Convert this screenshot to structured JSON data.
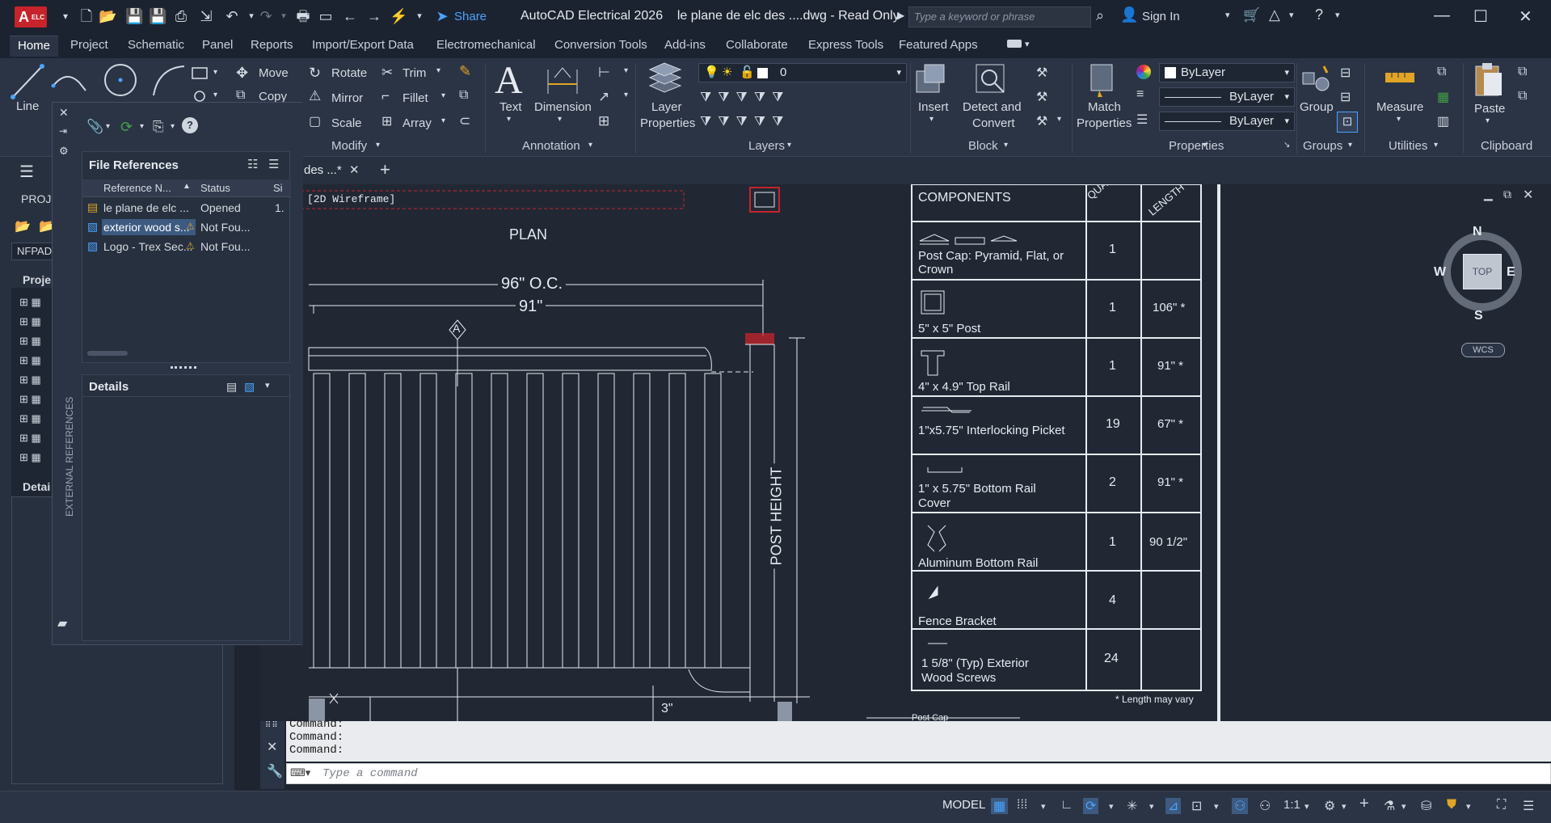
{
  "app": {
    "logo_text": "A",
    "logo_badge": "ELC",
    "share_label": "Share",
    "title": "AutoCAD Electrical 2026",
    "document": "le plane de elc des ....dwg - Read Only",
    "search_placeholder": "Type a keyword or phrase",
    "sign_in": "Sign In"
  },
  "ribbon_tabs": [
    "Home",
    "Project",
    "Schematic",
    "Panel",
    "Reports",
    "Import/Export Data",
    "Electromechanical",
    "Conversion Tools",
    "Add-ins",
    "Collaborate",
    "Express Tools",
    "Featured Apps"
  ],
  "ribbon": {
    "draw": {
      "line": "Line"
    },
    "modify": {
      "move": "Move",
      "copy": "Copy",
      "rotate": "Rotate",
      "mirror": "Mirror",
      "scale": "Scale",
      "trim": "Trim",
      "fillet": "Fillet",
      "array": "Array",
      "panel": "Modify"
    },
    "annotation": {
      "text": "Text",
      "dimension": "Dimension",
      "panel": "Annotation"
    },
    "layers": {
      "layer_properties_1": "Layer",
      "layer_properties_2": "Properties",
      "current_layer": "0",
      "panel": "Layers"
    },
    "block": {
      "insert": "Insert",
      "detect_1": "Detect and",
      "detect_2": "Convert",
      "panel": "Block"
    },
    "properties": {
      "match_1": "Match",
      "match_2": "Properties",
      "color": "ByLayer",
      "linetype": "ByLayer",
      "lineweight": "ByLayer",
      "panel": "Properties"
    },
    "groups": {
      "group": "Group",
      "panel": "Groups"
    },
    "utilities": {
      "measure": "Measure",
      "panel": "Utilities"
    },
    "clipboard": {
      "paste": "Paste",
      "panel": "Clipboard"
    }
  },
  "doc_tab": "des ...*",
  "palette": {
    "project_header": "PROJE",
    "nfpa": "NFPAD",
    "projects_label": "Proje",
    "details_label": "Detai",
    "tree_count": 9
  },
  "xref": {
    "vertical_title": "EXTERNAL REFERENCES",
    "file_references": "File References",
    "columns": [
      "Reference N...",
      "Status",
      "Si"
    ],
    "rows": [
      {
        "name": "le plane de elc ...",
        "status": "Opened",
        "size": "1.",
        "warn": false
      },
      {
        "name": "exterior wood s...",
        "status": "Not Fou...",
        "size": "",
        "warn": true
      },
      {
        "name": "Logo - Trex Sec...",
        "status": "Not Fou...",
        "size": "",
        "warn": true
      }
    ],
    "details": "Details"
  },
  "viewport": {
    "label": "[2D Wireframe]",
    "plan": "PLAN",
    "dim_oc": "96\" O.C.",
    "dim_91": "91\"",
    "marker_a": "A",
    "post_height": "POST HEIGHT",
    "dim_3": "3\"",
    "post_cap_label": "Post Cap"
  },
  "components": {
    "header": "COMPONENTS",
    "qty_header": "QUANTITY",
    "len_header": "LENGTH",
    "rows": [
      {
        "name": "Post Cap: Pyramid, Flat, or Crown",
        "qty": "1",
        "len": ""
      },
      {
        "name": "5\" x 5\" Post",
        "qty": "1",
        "len": "106\" *"
      },
      {
        "name": "4\" x 4.9\" Top Rail",
        "qty": "1",
        "len": "91\" *"
      },
      {
        "name": "1\"x5.75\" Interlocking Picket",
        "qty": "19",
        "len": "67\" *"
      },
      {
        "name": "1\" x 5.75\" Bottom Rail Cover",
        "qty": "2",
        "len": "91\" *"
      },
      {
        "name": "Aluminum Bottom Rail",
        "qty": "1",
        "len": "90 1/2\""
      },
      {
        "name": "Fence Bracket",
        "qty": "4",
        "len": ""
      },
      {
        "name": "1 5/8\" (Typ) Exterior Wood Screws",
        "qty": "24",
        "len": ""
      }
    ],
    "footnote": "* Length may vary"
  },
  "viewcube": {
    "n": "N",
    "s": "S",
    "e": "E",
    "w": "W",
    "top": "TOP",
    "wcs": "WCS"
  },
  "command": {
    "history": [
      "Command:",
      "Command:",
      "Command:"
    ],
    "placeholder": "Type a command"
  },
  "statusbar": {
    "model": "MODEL",
    "scale": "1:1"
  },
  "colors": {
    "accent": "#4aa3ff",
    "logo": "#c7232b",
    "canvas": "#212834",
    "warning": "#e0a526"
  }
}
